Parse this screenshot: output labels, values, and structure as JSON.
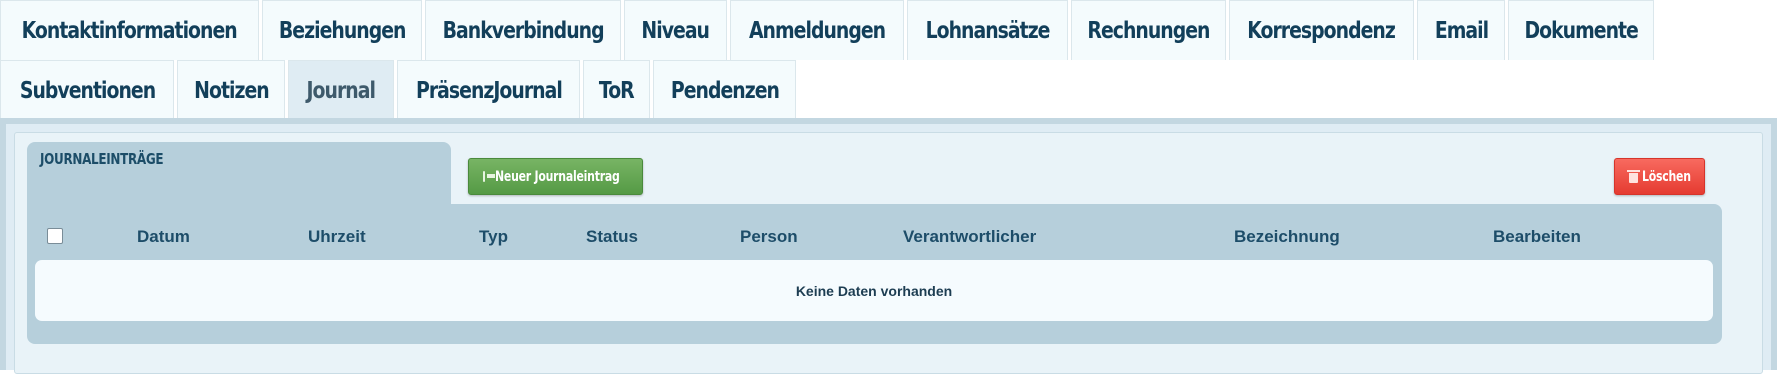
{
  "tabs": {
    "row1": [
      "Kontaktinformationen",
      "Beziehungen",
      "Bankverbindung",
      "Niveau",
      "Anmeldungen",
      "Lohnansätze",
      "Rechnungen",
      "Korrespondenz",
      "Email",
      "Dokumente"
    ],
    "row2": [
      "Subventionen",
      "Notizen",
      "Journal",
      "PräsenzJournal",
      "ToR",
      "Pendenzen"
    ],
    "active": "Journal"
  },
  "panel": {
    "title": "JOURNALEINTRÄGE",
    "new_button": "Neuer Journaleintrag",
    "delete_button": "Löschen"
  },
  "table": {
    "columns": [
      "Datum",
      "Uhrzeit",
      "Typ",
      "Status",
      "Person",
      "Verantwortlicher",
      "Bezeichnung",
      "Bearbeiten"
    ],
    "empty_message": "Keine Daten vorhanden"
  },
  "colors": {
    "tab_text": "#123f5a",
    "new_button": "#5fa24d",
    "delete_button": "#ee4b41",
    "panel_bg": "#dfecf4"
  }
}
